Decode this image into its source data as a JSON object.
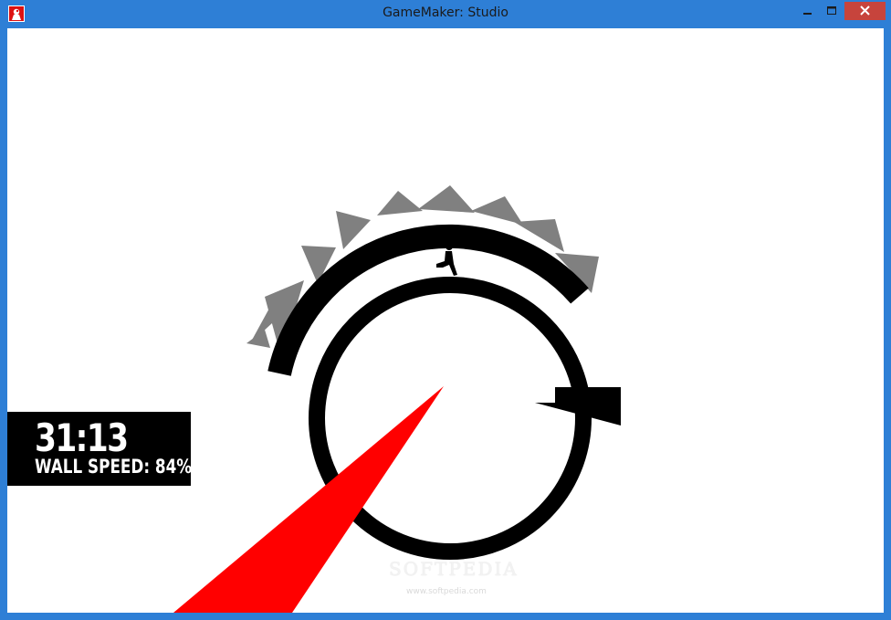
{
  "window": {
    "title": "GameMaker: Studio",
    "icons": {
      "app": "app-icon",
      "minimize": "minimize-icon",
      "maximize": "maximize-icon",
      "close": "close-icon"
    },
    "colors": {
      "frame": "#2e7fd6",
      "close_button": "#c7443c"
    }
  },
  "hud": {
    "timer": "31:13",
    "wall_speed_label": "WALL SPEED:",
    "wall_speed_value": "84%"
  },
  "game": {
    "colors": {
      "background": "#ffffff",
      "ring": "#000000",
      "spikes": "#808080",
      "laser": "#ff0000"
    },
    "icons": {
      "player": "running-figure-icon"
    }
  },
  "watermark": {
    "brand": "SOFTPEDIA",
    "url": "www.softpedia.com"
  }
}
